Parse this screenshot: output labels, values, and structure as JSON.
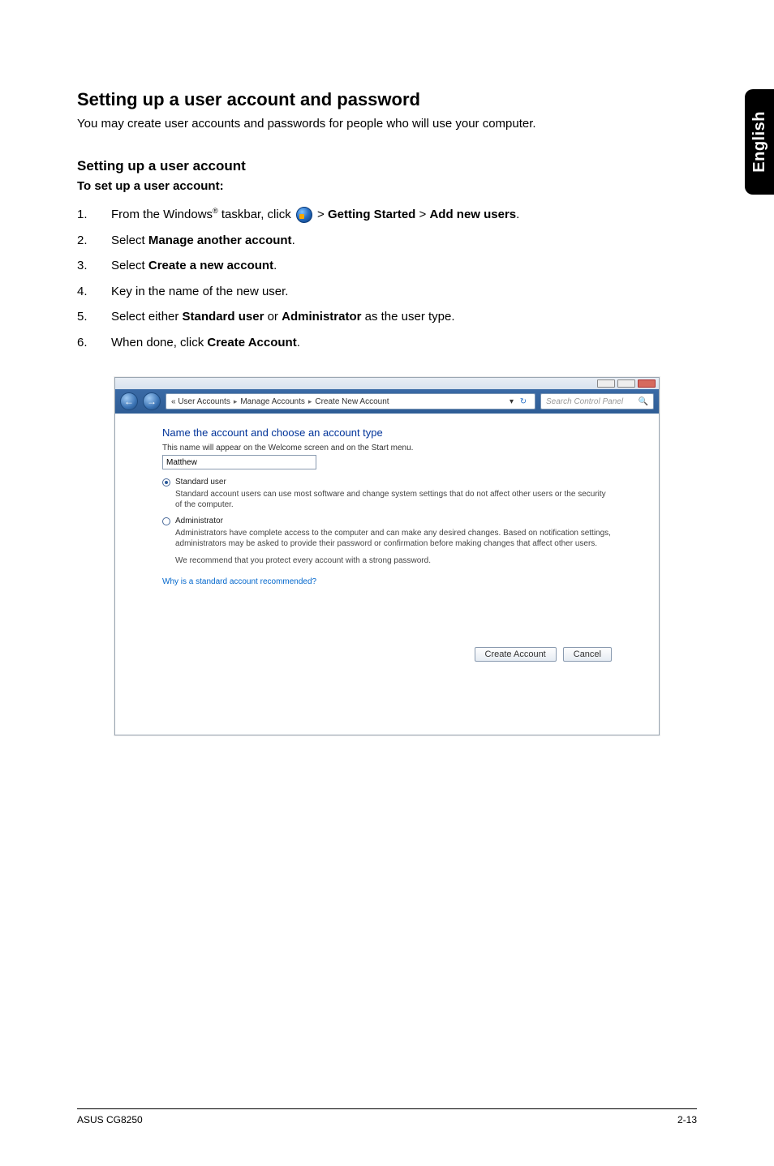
{
  "sideTab": "English",
  "title": "Setting up a user account and password",
  "intro": "You may create user accounts and passwords for people who will use your computer.",
  "subTitle": "Setting up a user account",
  "subBold": "To set up a user account:",
  "steps": {
    "s1_a": "From the Windows",
    "s1_sup": "®",
    "s1_b": " taskbar, click ",
    "s1_c": " > ",
    "s1_bold1": "Getting Started",
    "s1_d": " > ",
    "s1_bold2": "Add new users",
    "s1_e": ".",
    "s2_a": "Select ",
    "s2_bold": "Manage another account",
    "s2_b": ".",
    "s3_a": "Select ",
    "s3_bold": "Create a new account",
    "s3_b": ".",
    "s4": "Key in the name of the new user.",
    "s5_a": "Select either ",
    "s5_bold1": "Standard user",
    "s5_b": " or ",
    "s5_bold2": "Administrator",
    "s5_c": " as the user type.",
    "s6_a": "When done, click ",
    "s6_bold": "Create Account",
    "s6_b": "."
  },
  "window": {
    "crumbIcon": "",
    "crumbSep": "▸",
    "crumb1": "« User Accounts",
    "crumb2": "Manage Accounts",
    "crumb3": "Create New Account",
    "searchPlaceholder": "Search Control Panel",
    "heading": "Name the account and choose an account type",
    "sub": "This name will appear on the Welcome screen and on the Start menu.",
    "inputValue": "Matthew",
    "opt1Label": "Standard user",
    "opt1Desc": "Standard account users can use most software and change system settings that do not affect other users or the security of the computer.",
    "opt2Label": "Administrator",
    "opt2Desc1": "Administrators have complete access to the computer and can make any desired changes. Based on notification settings, administrators may be asked to provide their password or confirmation before making changes that affect other users.",
    "opt2Desc2": "We recommend that you protect every account with a strong password.",
    "link": "Why is a standard account recommended?",
    "btnCreate": "Create Account",
    "btnCancel": "Cancel"
  },
  "footer": {
    "left": "ASUS CG8250",
    "right": "2-13"
  }
}
